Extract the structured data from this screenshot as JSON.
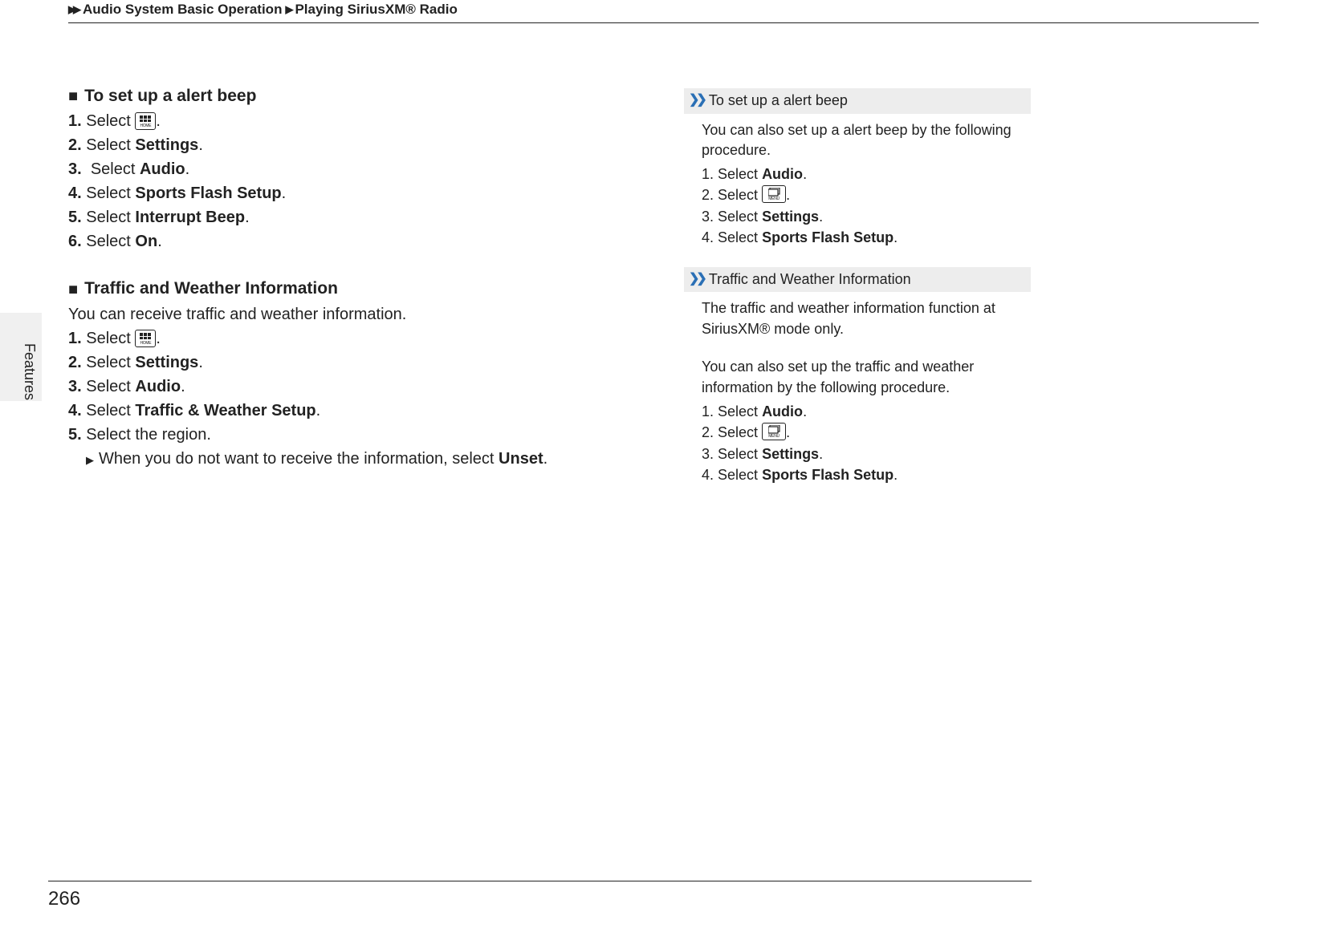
{
  "breadcrumb": {
    "part1": "Audio System Basic Operation",
    "part2": "Playing SiriusXM® Radio"
  },
  "sideTabLabel": "Features",
  "pageNumber": "266",
  "sectionA": {
    "title": "To set up a alert beep",
    "s1a": "1.",
    "s1b": "Select ",
    "s1c": ".",
    "s2a": "2.",
    "s2b": "Select ",
    "s2c": "Settings",
    "s2d": ".",
    "s3a": "3.",
    "s3b": "Select ",
    "s3c": "Audio",
    "s3d": ".",
    "s4a": "4.",
    "s4b": "Select ",
    "s4c": "Sports Flash Setup",
    "s4d": ".",
    "s5a": "5.",
    "s5b": "Select ",
    "s5c": "Interrupt Beep",
    "s5d": ".",
    "s6a": "6.",
    "s6b": "Select ",
    "s6c": "On",
    "s6d": "."
  },
  "sectionB": {
    "title": "Traffic and Weather Information",
    "intro": "You can receive traffic and weather information.",
    "s1a": "1.",
    "s1b": "Select ",
    "s1c": ".",
    "s2a": "2.",
    "s2b": "Select ",
    "s2c": "Settings",
    "s2d": ".",
    "s3a": "3.",
    "s3b": "Select ",
    "s3c": "Audio",
    "s3d": ".",
    "s4a": "4.",
    "s4b": "Select ",
    "s4c": "Traffic & Weather Setup",
    "s4d": ".",
    "s5a": "5.",
    "s5b": "Select the region.",
    "sub1a": "When you do not want to receive the information, select ",
    "sub1b": "Unset",
    "sub1c": "."
  },
  "noteA": {
    "title": "To set up a alert beep",
    "intro": "You can also set up a alert beep by the following procedure.",
    "s1a": "1.",
    "s1b": "Select ",
    "s1c": "Audio",
    "s1d": ".",
    "s2a": "2.",
    "s2b": "Select ",
    "s2c": ".",
    "s3a": "3.",
    "s3b": "Select ",
    "s3c": "Settings",
    "s3d": ".",
    "s4a": "4.",
    "s4b": "Select ",
    "s4c": "Sports Flash Setup",
    "s4d": "."
  },
  "noteB": {
    "title": "Traffic and Weather Information",
    "intro1": "The traffic and weather information function at SiriusXM® mode only.",
    "intro2": "You can also set up the traffic and weather information by the following procedure.",
    "s1a": "1.",
    "s1b": "Select ",
    "s1c": "Audio",
    "s1d": ".",
    "s2a": "2.",
    "s2b": "Select ",
    "s2c": ".",
    "s3a": "3.",
    "s3b": "Select ",
    "s3c": "Settings",
    "s3d": ".",
    "s4a": "4.",
    "s4b": "Select ",
    "s4c": "Sports Flash Setup",
    "s4d": "."
  }
}
